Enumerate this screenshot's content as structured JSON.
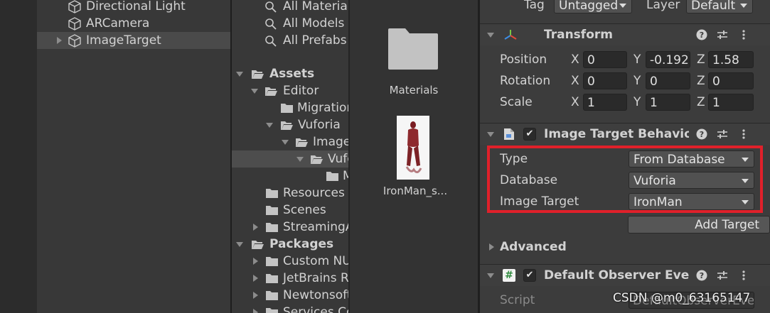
{
  "hierarchy": {
    "items": [
      {
        "label": "Directional Light"
      },
      {
        "label": "ARCamera"
      },
      {
        "label": "ImageTarget"
      }
    ]
  },
  "project": {
    "search_filters": [
      "All Materials",
      "All Models",
      "All Prefabs"
    ],
    "tree": {
      "assets": "Assets",
      "editor": "Editor",
      "migration": "Migration",
      "vuforia": "Vuforia",
      "image_targets": "ImageTargetTextures",
      "vuforia_sub": "Vuforia",
      "deep_item": "M",
      "resources": "Resources",
      "scenes": "Scenes",
      "streaming": "StreamingAssets",
      "packages": "Packages",
      "custom_nunit": "Custom NUnit",
      "jetbrains": "JetBrains Rider Editor",
      "newtonsoft": "Newtonsoft Json",
      "services": "Services Core"
    },
    "grid": [
      {
        "label": "Materials",
        "icon": "folder-icon"
      },
      {
        "label": "IronMan_s...",
        "icon": "ironman-thumbnail"
      }
    ]
  },
  "inspector": {
    "tag_label": "Tag",
    "tag_value": "Untagged",
    "layer_label": "Layer",
    "layer_value": "Default",
    "transform": {
      "title": "Transform",
      "position_label": "Position",
      "rotation_label": "Rotation",
      "scale_label": "Scale",
      "x": "X",
      "y": "Y",
      "z": "Z",
      "position": {
        "x": "0",
        "y": "-0.192",
        "z": "1.58"
      },
      "rotation": {
        "x": "0",
        "y": "0",
        "z": "0"
      },
      "scale": {
        "x": "1",
        "y": "1",
        "z": "1"
      }
    },
    "image_target": {
      "title": "Image Target Behaviour",
      "check": "✔",
      "type_label": "Type",
      "type_value": "From Database",
      "database_label": "Database",
      "database_value": "Vuforia",
      "target_label": "Image Target",
      "target_value": "IronMan",
      "add_target": "Add Target",
      "advanced": "Advanced"
    },
    "observer": {
      "title": "Default Observer Event Handler",
      "check": "✔",
      "script_label": "Script",
      "script_value": "DefaultObserverEventHandler"
    },
    "highlight_color": "#e0202a"
  },
  "watermark": "CSDN @m0_63165147"
}
